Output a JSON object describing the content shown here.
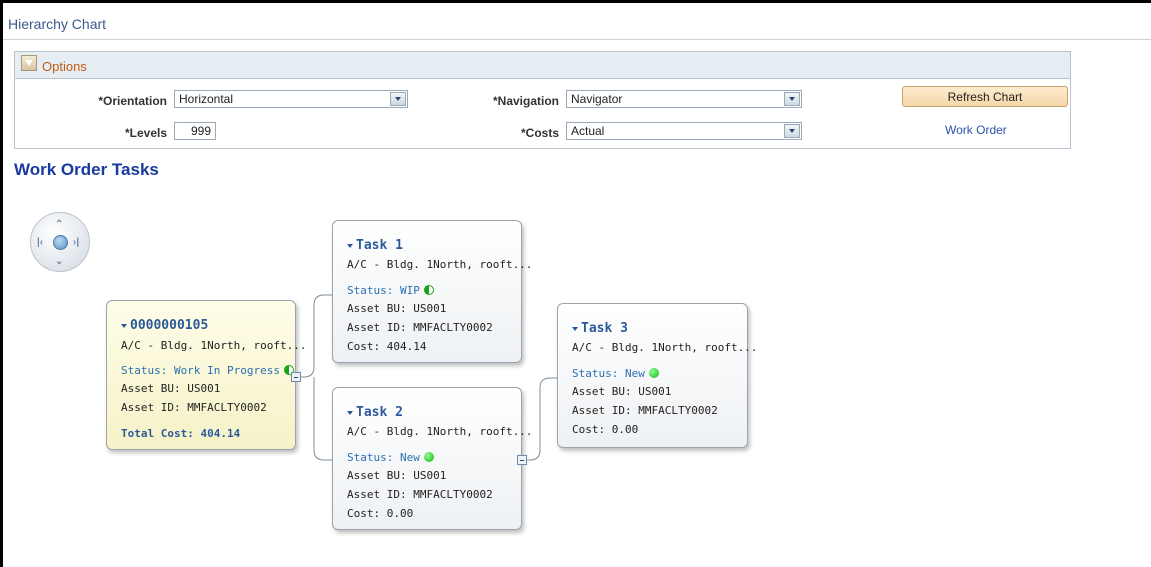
{
  "page": {
    "title": "Hierarchy Chart"
  },
  "options": {
    "header": "Options",
    "orientation": {
      "label": "*Orientation",
      "value": "Horizontal"
    },
    "navigation": {
      "label": "*Navigation",
      "value": "Navigator"
    },
    "levels": {
      "label": "*Levels",
      "value": "999"
    },
    "costs": {
      "label": "*Costs",
      "value": "Actual"
    },
    "refresh_label": "Refresh Chart",
    "work_order_link": "Work Order"
  },
  "section": {
    "title": "Work Order Tasks"
  },
  "nodes": {
    "root": {
      "name": "0000000105",
      "desc": "A/C - Bldg. 1North, rooft...",
      "status": "Status: Work In Progress",
      "asset_bu": "Asset BU: US001",
      "asset_id": "Asset ID: MMFACLTY0002",
      "total_cost": "Total Cost: 404.14"
    },
    "task1": {
      "name": "Task 1",
      "desc": "A/C - Bldg. 1North, rooft...",
      "status": "Status: WIP",
      "asset_bu": "Asset BU: US001",
      "asset_id": "Asset ID: MMFACLTY0002",
      "cost": "Cost: 404.14"
    },
    "task2": {
      "name": "Task 2",
      "desc": "A/C - Bldg. 1North, rooft...",
      "status": "Status: New",
      "asset_bu": "Asset BU: US001",
      "asset_id": "Asset ID: MMFACLTY0002",
      "cost": "Cost: 0.00"
    },
    "task3": {
      "name": "Task 3",
      "desc": "A/C - Bldg. 1North, rooft...",
      "status": "Status: New",
      "asset_bu": "Asset BU: US001",
      "asset_id": "Asset ID: MMFACLTY0002",
      "cost": "Cost: 0.00"
    }
  },
  "colors": {
    "title_blue": "#1a3aa0",
    "status_green": "#17b317",
    "button_orange": "#f6d7a8"
  }
}
